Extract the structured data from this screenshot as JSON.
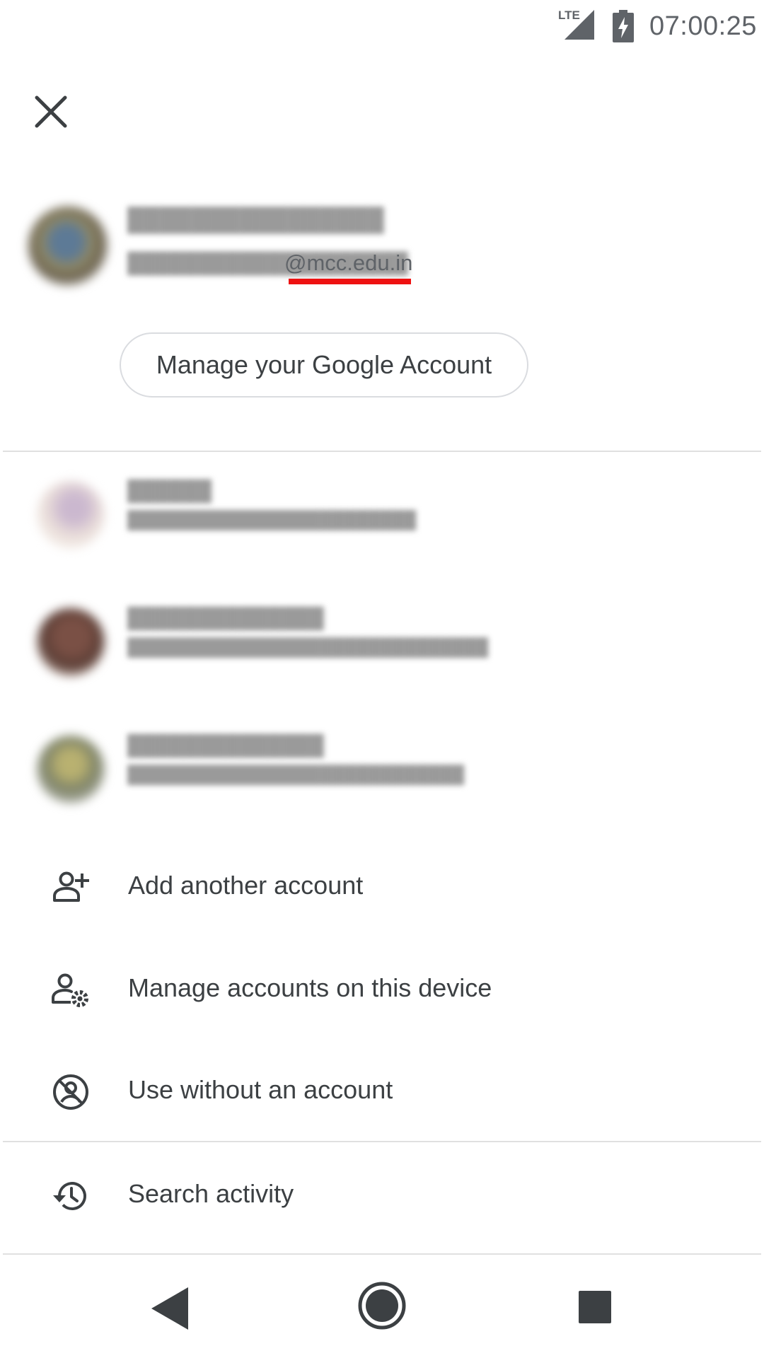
{
  "status_bar": {
    "network": "LTE",
    "time": "07:00:25"
  },
  "header": {
    "close_icon": "close-icon"
  },
  "current_account": {
    "name": "████████████████",
    "email_local": "████████████████████",
    "email_domain": "@mcc.edu.in",
    "manage_button": "Manage your Google Account"
  },
  "other_accounts": [
    {
      "name": "██████",
      "email": "████████████████████████"
    },
    {
      "name": "██████████████",
      "email": "██████████████████████████████"
    },
    {
      "name": "██████████████",
      "email": "████████████████████████████"
    }
  ],
  "actions": [
    {
      "label": "Add another account",
      "icon": "person-add-icon"
    },
    {
      "label": "Manage accounts on this device",
      "icon": "manage-accounts-icon"
    },
    {
      "label": "Use without an account",
      "icon": "no-account-icon"
    }
  ],
  "footer_actions": [
    {
      "label": "Search activity",
      "icon": "history-icon"
    }
  ],
  "nav": {
    "back": "back-icon",
    "home": "home-icon",
    "recents": "recents-icon"
  }
}
